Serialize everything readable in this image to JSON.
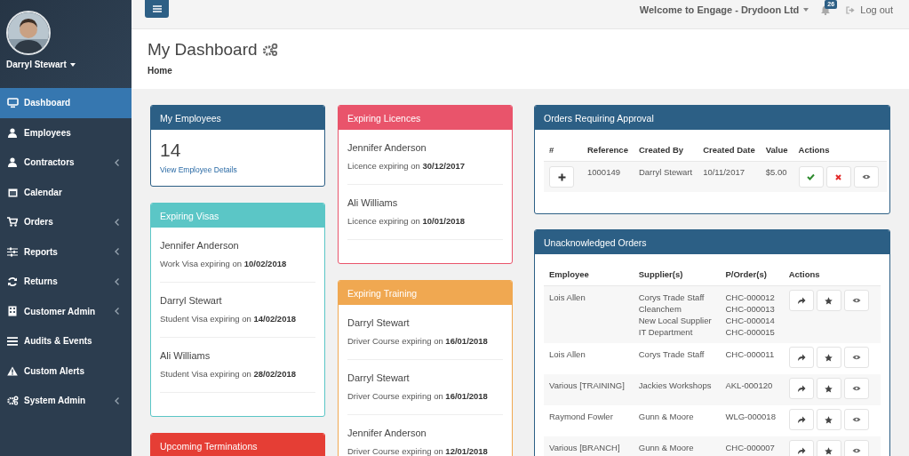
{
  "topbar": {
    "welcome": "Welcome to Engage - Drydoon Ltd",
    "notifications": "26",
    "logout": "Log out"
  },
  "sidebar": {
    "user": "Darryl Stewart",
    "items": [
      {
        "label": "Dashboard",
        "selected": true,
        "submenu": false
      },
      {
        "label": "Employees",
        "selected": false,
        "submenu": false
      },
      {
        "label": "Contractors",
        "selected": false,
        "submenu": true
      },
      {
        "label": "Calendar",
        "selected": false,
        "submenu": false
      },
      {
        "label": "Orders",
        "selected": false,
        "submenu": true
      },
      {
        "label": "Reports",
        "selected": false,
        "submenu": true
      },
      {
        "label": "Returns",
        "selected": false,
        "submenu": true
      },
      {
        "label": "Customer Admin",
        "selected": false,
        "submenu": true
      },
      {
        "label": "Audits & Events",
        "selected": false,
        "submenu": false
      },
      {
        "label": "Custom Alerts",
        "selected": false,
        "submenu": false
      },
      {
        "label": "System Admin",
        "selected": false,
        "submenu": true
      }
    ]
  },
  "header": {
    "title": "My Dashboard",
    "breadcrumb": "Home"
  },
  "columns": [
    [
      {
        "kind": "stat",
        "title": "My Employees",
        "color": "#2c5f85",
        "count": "14",
        "link": "View Employee Details"
      },
      {
        "kind": "list",
        "title": "Expiring Visas",
        "color": "#5bc6c6",
        "items": [
          {
            "name": "Jennifer Anderson",
            "detail": "Work Visa expiring on **10/02/2018**"
          },
          {
            "name": "Darryl Stewart",
            "detail": "Student Visa expiring on **14/02/2018**"
          },
          {
            "name": "Ali Williams",
            "detail": "Student Visa expiring on **28/02/2018**"
          }
        ]
      },
      {
        "kind": "list",
        "title": "Upcoming Terminations",
        "color": "#e53e35"
      }
    ],
    [
      {
        "kind": "list",
        "title": "Expiring Licences",
        "color": "#e9546b",
        "items": [
          {
            "name": "Jennifer Anderson",
            "detail": "Licence expiring on **30/12/2017**"
          },
          {
            "name": "Ali Williams",
            "detail": "Licence expiring on **10/01/2018**"
          }
        ]
      },
      {
        "kind": "list",
        "title": "Expiring Training",
        "color": "#f0a851",
        "items": [
          {
            "name": "Darryl Stewart",
            "detail": "Driver Course expiring on **16/01/2018**"
          },
          {
            "name": "Darryl Stewart",
            "detail": "Driver Course expiring on **16/01/2018**"
          },
          {
            "name": "Jennifer Anderson",
            "detail": "Driver Course expiring on **12/01/2018**"
          }
        ]
      }
    ]
  ],
  "approval_panel": {
    "title": "Orders Requiring Approval",
    "columns": [
      "#",
      "Reference",
      "Created By",
      "Created Date",
      "Value",
      "Actions"
    ],
    "rows": [
      {
        "reference": "1000149",
        "created_by": "Darryl Stewart",
        "created_date": "10/11/2017",
        "value": "$5.00",
        "actions": [
          {
            "kind": "approve"
          },
          {
            "kind": "reject"
          },
          {
            "kind": "view"
          }
        ]
      }
    ]
  },
  "unacknowledged_panel": {
    "title": "Unacknowledged Orders",
    "columns": [
      "Employee",
      "Supplier(s)",
      "P/Order(s)",
      "Actions"
    ],
    "rows": [
      {
        "employee": "Lois Allen",
        "suppliers": [
          "Corys Trade Staff",
          "Cleanchem",
          "New Local Supplier",
          "IT Department"
        ],
        "orders": [
          "CHC-000012",
          "CHC-000013",
          "CHC-000014",
          "CHC-000015"
        ],
        "actions": [
          {
            "kind": "forward"
          },
          {
            "kind": "star"
          },
          {
            "kind": "view"
          }
        ]
      },
      {
        "employee": "Lois Allen",
        "suppliers": [
          "Corys Trade Staff"
        ],
        "orders": [
          "CHC-000011"
        ],
        "actions": [
          {
            "kind": "forward"
          },
          {
            "kind": "star"
          },
          {
            "kind": "view"
          }
        ]
      },
      {
        "employee": "Various [TRAINING]",
        "suppliers": [
          "Jackies Workshops"
        ],
        "orders": [
          "AKL-000120"
        ],
        "actions": [
          {
            "kind": "forward"
          },
          {
            "kind": "star"
          },
          {
            "kind": "view"
          }
        ]
      },
      {
        "employee": "Raymond Fowler",
        "suppliers": [
          "Gunn & Moore"
        ],
        "orders": [
          "WLG-000018"
        ],
        "actions": [
          {
            "kind": "forward"
          },
          {
            "kind": "star"
          },
          {
            "kind": "view"
          }
        ]
      },
      {
        "employee": "Various [BRANCH]",
        "suppliers": [
          "Gunn & Moore"
        ],
        "orders": [
          "CHC-000007"
        ],
        "actions": [
          {
            "kind": "forward"
          },
          {
            "kind": "star"
          },
          {
            "kind": "view"
          }
        ]
      }
    ]
  }
}
